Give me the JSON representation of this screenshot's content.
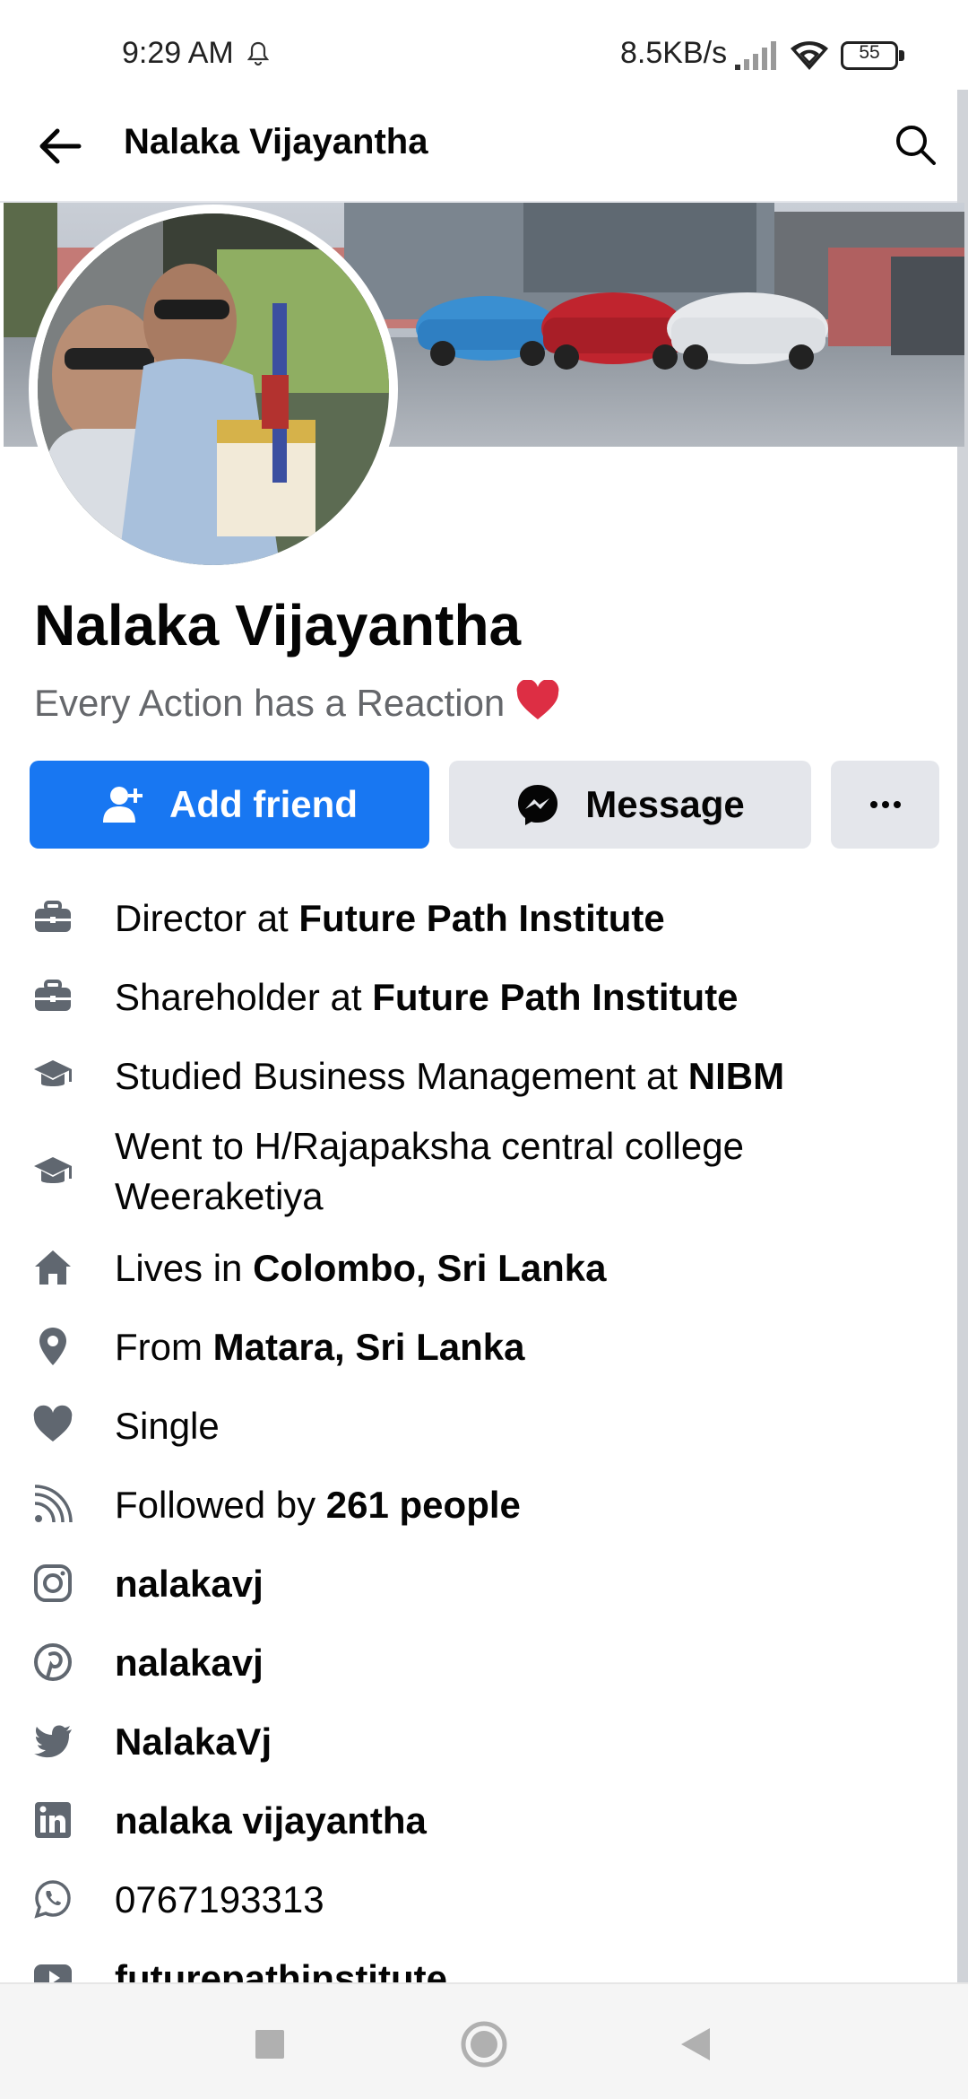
{
  "status_bar": {
    "time": "9:29 AM",
    "net_speed": "8.5KB/s",
    "battery": "55",
    "icons": [
      "bell-icon",
      "signal-icon",
      "wifi-icon",
      "battery-icon"
    ]
  },
  "topbar": {
    "title": "Nalaka Vijayantha",
    "icons": [
      "back-arrow-icon",
      "search-icon"
    ]
  },
  "profile": {
    "name": "Nalaka Vijayantha",
    "bio": "Every Action has a Reaction",
    "bio_emoji": "red-heart-emoji"
  },
  "actions": {
    "add_friend": "Add friend",
    "message": "Message",
    "more_icon": "more-dots-icon"
  },
  "details": {
    "work1": {
      "prefix": "Director at ",
      "bold": "Future Path Institute",
      "icon": "briefcase-icon"
    },
    "work2": {
      "prefix": "Shareholder at ",
      "bold": "Future Path Institute",
      "icon": "briefcase-icon"
    },
    "edu1": {
      "prefix": "Studied Business Management at ",
      "bold": "NIBM",
      "icon": "graduation-cap-icon"
    },
    "edu2": {
      "line1": "Went to H/Rajapaksha central college",
      "line2": "Weeraketiya",
      "icon": "graduation-cap-icon"
    },
    "lives": {
      "prefix": "Lives in ",
      "bold": "Colombo, Sri Lanka",
      "icon": "home-icon"
    },
    "from": {
      "prefix": "From ",
      "bold": "Matara, Sri Lanka",
      "icon": "location-pin-icon"
    },
    "relationship": {
      "text": "Single",
      "icon": "heart-icon"
    },
    "followers": {
      "prefix": "Followed by ",
      "bold": "261 people",
      "icon": "rss-icon"
    },
    "instagram": {
      "bold": "nalakavj",
      "icon": "instagram-icon"
    },
    "pinterest": {
      "bold": "nalakavj",
      "icon": "pinterest-icon"
    },
    "twitter": {
      "bold": "NalakaVj",
      "icon": "twitter-icon"
    },
    "linkedin": {
      "bold": "nalaka vijayantha",
      "icon": "linkedin-icon"
    },
    "whatsapp": {
      "text": "0767193313",
      "icon": "whatsapp-icon"
    },
    "youtube": {
      "bold": "futurepathinstitute",
      "icon": "youtube-icon"
    }
  },
  "navbar": {
    "icons": [
      "recents-square-icon",
      "home-circle-icon",
      "back-triangle-icon"
    ]
  },
  "colors": {
    "primary": "#1877f2",
    "secondary_button": "#e4e6eb",
    "text": "#050505",
    "muted_text": "#65676b",
    "icon": "#606770"
  }
}
